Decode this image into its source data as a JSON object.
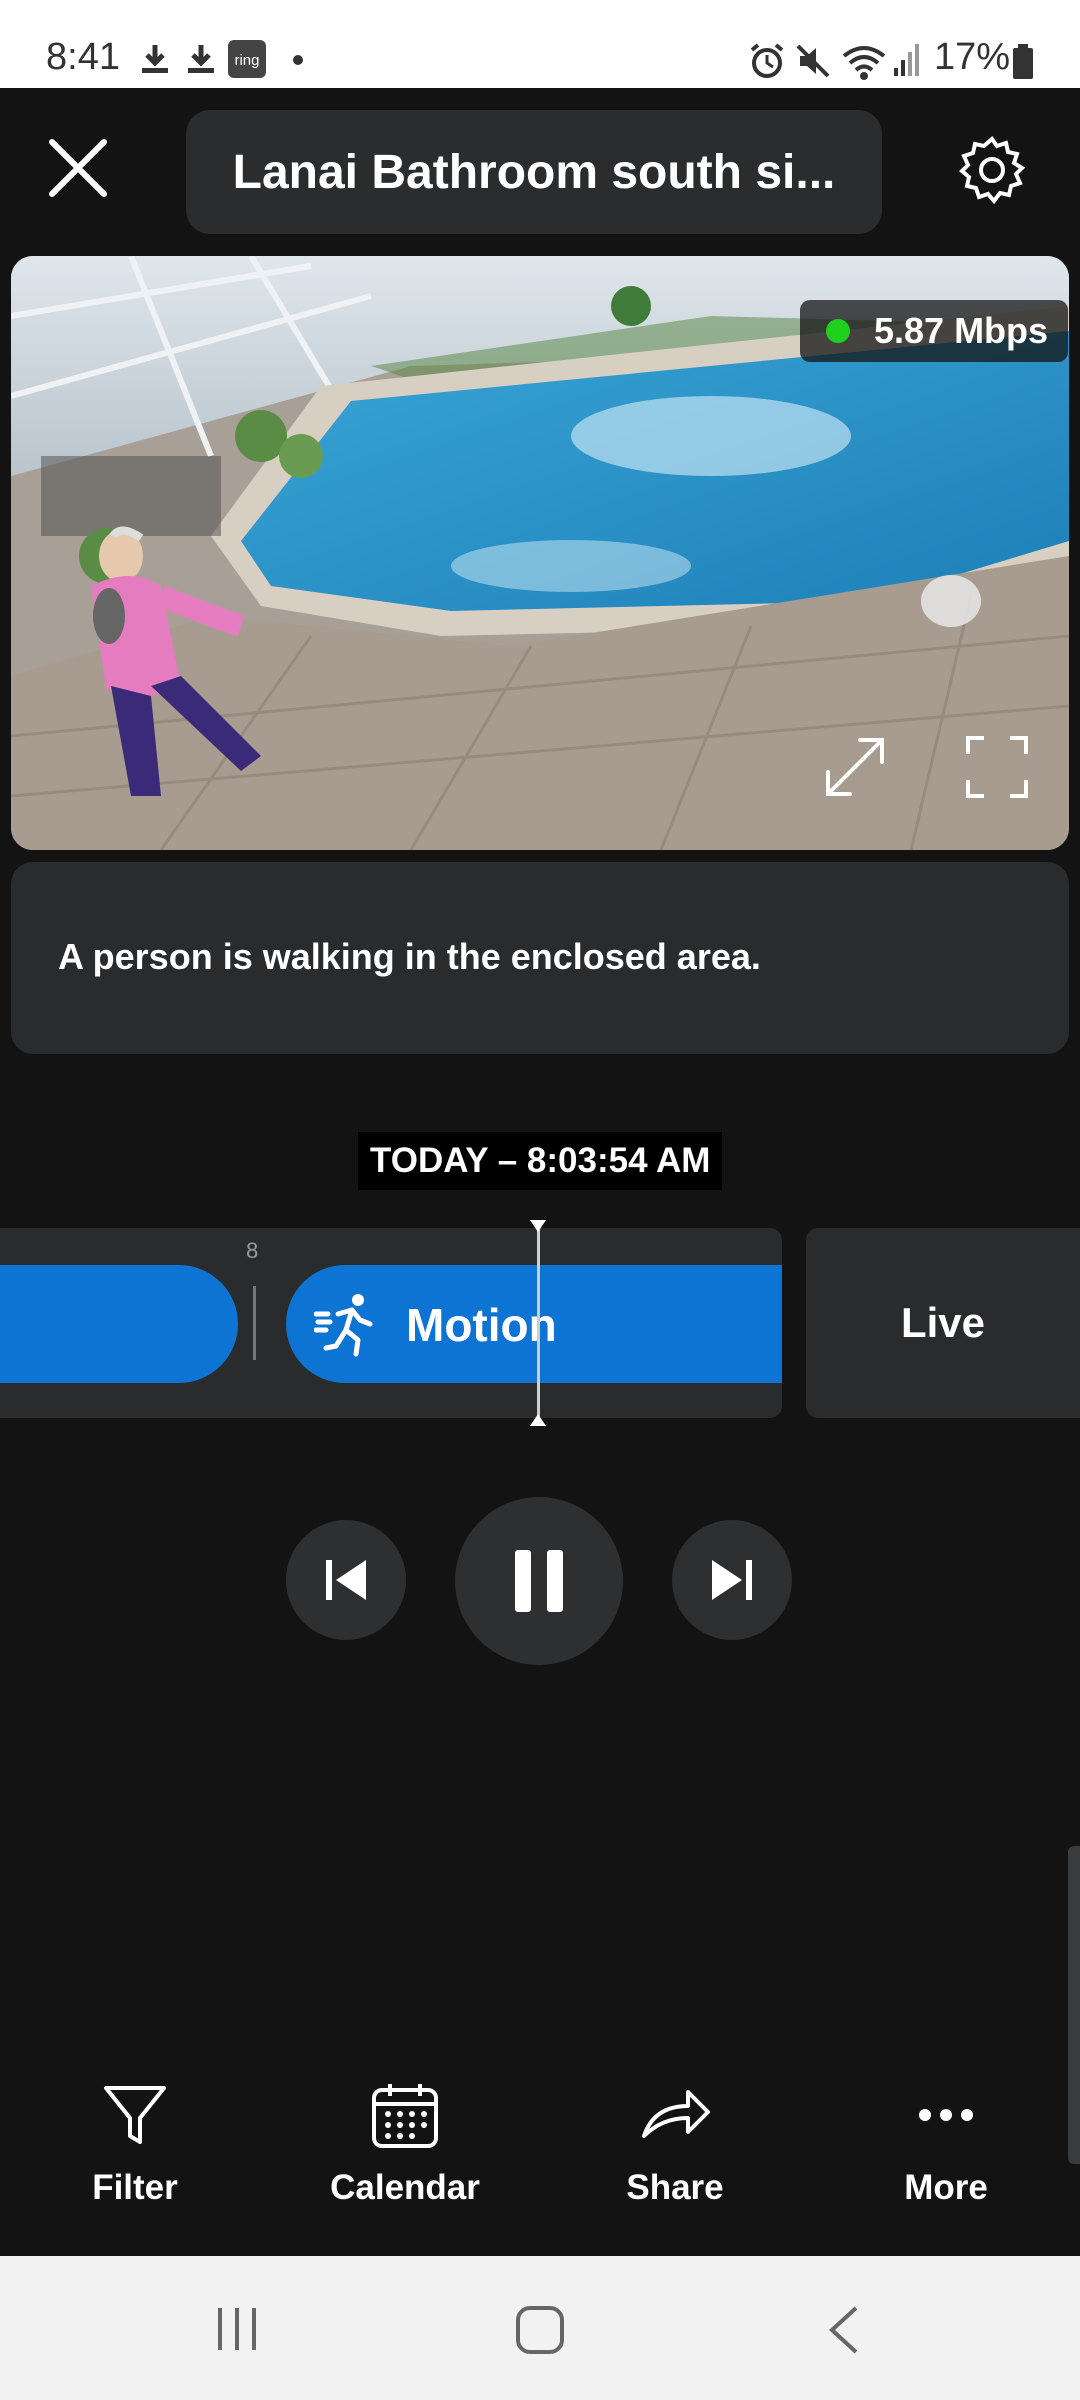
{
  "status_bar": {
    "time": "8:41",
    "battery": "17%",
    "icons": [
      "download-icon",
      "download-icon",
      "ring-app-icon",
      "dot-icon",
      "alarm-icon",
      "mute-icon",
      "wifi-icon",
      "signal-icon",
      "battery-icon"
    ],
    "ring_label": "ring"
  },
  "header": {
    "title": "Lanai Bathroom south si..."
  },
  "video": {
    "bitrate": "5.87 Mbps",
    "bitrate_status_color": "#1fd01f"
  },
  "event": {
    "description": "A person is walking in the enclosed area.",
    "timestamp": "TODAY – 8:03:54 AM"
  },
  "timeline": {
    "tick_label": "8",
    "motion_label": "Motion",
    "live_label": "Live",
    "event_color": "#0e74d3"
  },
  "playback": {
    "state": "playing"
  },
  "actions": {
    "filter": "Filter",
    "calendar": "Calendar",
    "share": "Share",
    "more": "More"
  }
}
